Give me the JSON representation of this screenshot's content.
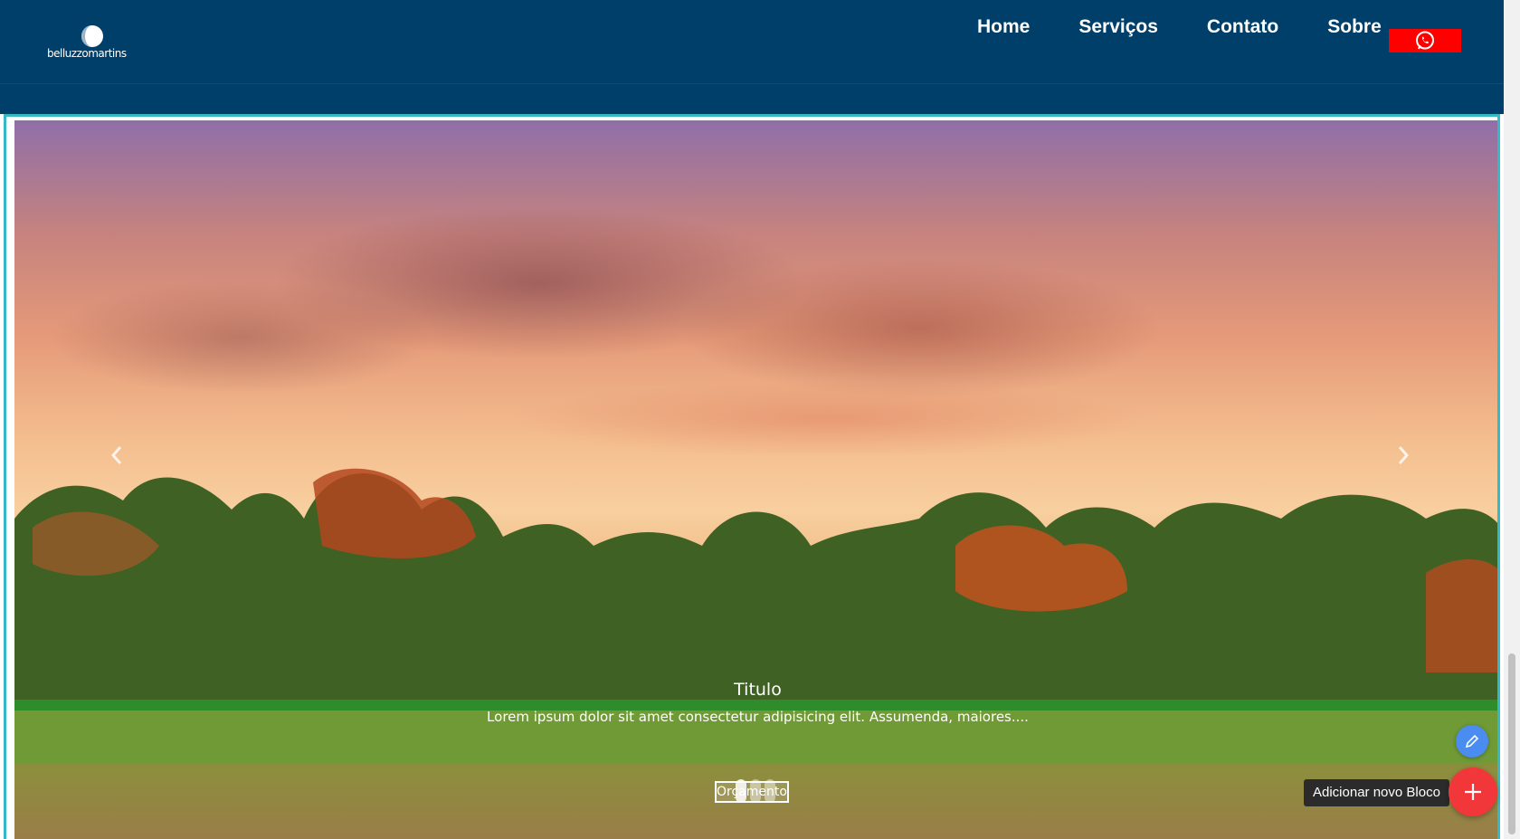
{
  "header": {
    "logo_text": "belluzzomartins",
    "nav": [
      "Home",
      "Serviços",
      "Contato",
      "Sobre"
    ],
    "whatsapp_icon": "whatsapp-icon"
  },
  "hero": {
    "title": "Titulo",
    "text": "Lorem ipsum dolor sit amet consectetur adipisicing elit. Assumenda, maiores....",
    "button": "Orçamento",
    "prev_icon": "chevron-left-icon",
    "next_icon": "chevron-right-icon"
  },
  "editor": {
    "add_block_tooltip": "Adicionar novo Bloco",
    "edit_icon": "pencil-icon",
    "add_icon": "plus-icon"
  },
  "colors": {
    "header_bg": "#003f6a",
    "whatsapp_bg": "#ff0000",
    "hero_border": "#36b9c4",
    "fab_edit": "#4a8cf0",
    "fab_add": "#f2373b"
  }
}
